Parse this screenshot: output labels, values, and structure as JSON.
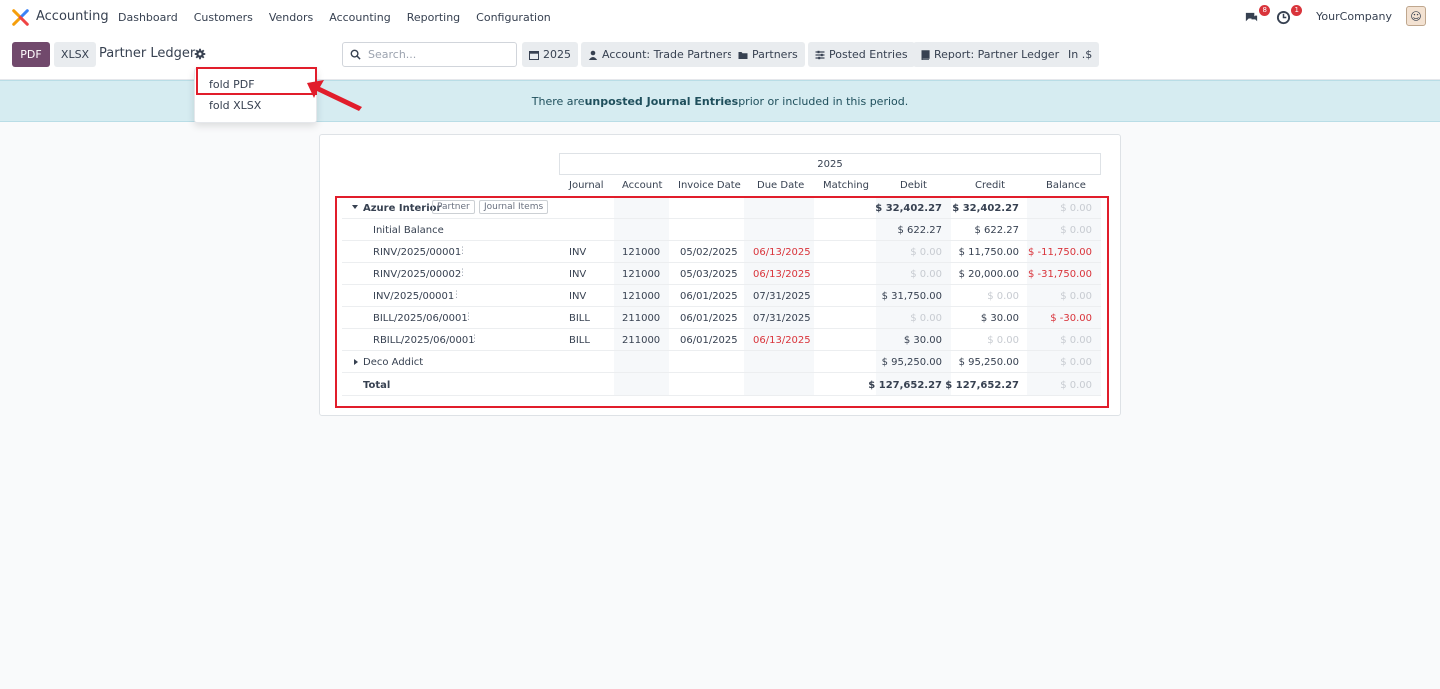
{
  "navbar": {
    "app_name": "Accounting",
    "menu": [
      "Dashboard",
      "Customers",
      "Vendors",
      "Accounting",
      "Reporting",
      "Configuration"
    ],
    "chat_badge": "8",
    "activity_badge": "1",
    "company": "YourCompany"
  },
  "controls": {
    "pdf_label": "PDF",
    "xlsx_label": "XLSX",
    "page_title": "Partner Ledger",
    "search_placeholder": "Search...",
    "filters": [
      {
        "label": "2025",
        "icon": "calendar-icon"
      },
      {
        "label": "Account: Trade Partners",
        "icon": "user-icon"
      },
      {
        "label": "Partners",
        "icon": "folder-icon"
      },
      {
        "label": "Posted Entries",
        "icon": "sliders-icon"
      },
      {
        "label": "Report: Partner Ledger",
        "icon": "book-icon"
      },
      {
        "label": "In .$",
        "icon": ""
      }
    ]
  },
  "dropdown": {
    "items": [
      "fold PDF",
      "fold XLSX"
    ]
  },
  "banner": {
    "prefix": "There are ",
    "bold": "unposted Journal Entries",
    "suffix": " prior or included in this period."
  },
  "report": {
    "period": "2025",
    "columns": [
      "Journal",
      "Account",
      "Invoice Date",
      "Due Date",
      "Matching",
      "Debit",
      "Credit",
      "Balance"
    ],
    "partner": {
      "name": "Azure Interior",
      "tag_partner": "Partner",
      "tag_journal_items": "Journal Items",
      "debit": "$ 32,402.27",
      "credit": "$ 32,402.27",
      "balance": "$ 0.00"
    },
    "initial_balance": {
      "label": "Initial Balance",
      "debit": "$ 622.27",
      "credit": "$ 622.27",
      "balance": "$ 0.00"
    },
    "lines": [
      {
        "name": "RINV/2025/00001",
        "journal": "INV",
        "account": "121000",
        "invoice_date": "05/02/2025",
        "due_date": "06/13/2025",
        "due_red": true,
        "debit": "$ 0.00",
        "credit": "$ 11,750.00",
        "balance": "$ -11,750.00",
        "debit_muted": true,
        "credit_muted": false,
        "balance_state": "red"
      },
      {
        "name": "RINV/2025/00002",
        "journal": "INV",
        "account": "121000",
        "invoice_date": "05/03/2025",
        "due_date": "06/13/2025",
        "due_red": true,
        "debit": "$ 0.00",
        "credit": "$ 20,000.00",
        "balance": "$ -31,750.00",
        "debit_muted": true,
        "credit_muted": false,
        "balance_state": "red"
      },
      {
        "name": "INV/2025/00001",
        "journal": "INV",
        "account": "121000",
        "invoice_date": "06/01/2025",
        "due_date": "07/31/2025",
        "due_red": false,
        "debit": "$ 31,750.00",
        "credit": "$ 0.00",
        "balance": "$ 0.00",
        "debit_muted": false,
        "credit_muted": true,
        "balance_state": "muted"
      },
      {
        "name": "BILL/2025/06/0001",
        "journal": "BILL",
        "account": "211000",
        "invoice_date": "06/01/2025",
        "due_date": "07/31/2025",
        "due_red": false,
        "debit": "$ 0.00",
        "credit": "$ 30.00",
        "balance": "$ -30.00",
        "debit_muted": true,
        "credit_muted": false,
        "balance_state": "red"
      },
      {
        "name": "RBILL/2025/06/0001",
        "journal": "BILL",
        "account": "211000",
        "invoice_date": "06/01/2025",
        "due_date": "06/13/2025",
        "due_red": true,
        "debit": "$ 30.00",
        "credit": "$ 0.00",
        "balance": "$ 0.00",
        "debit_muted": false,
        "credit_muted": true,
        "balance_state": "muted"
      }
    ],
    "partner2": {
      "name": "Deco Addict",
      "debit": "$ 95,250.00",
      "credit": "$ 95,250.00",
      "balance": "$ 0.00"
    },
    "total": {
      "label": "Total",
      "debit": "$ 127,652.27",
      "credit": "$ 127,652.27",
      "balance": "$ 0.00"
    }
  }
}
